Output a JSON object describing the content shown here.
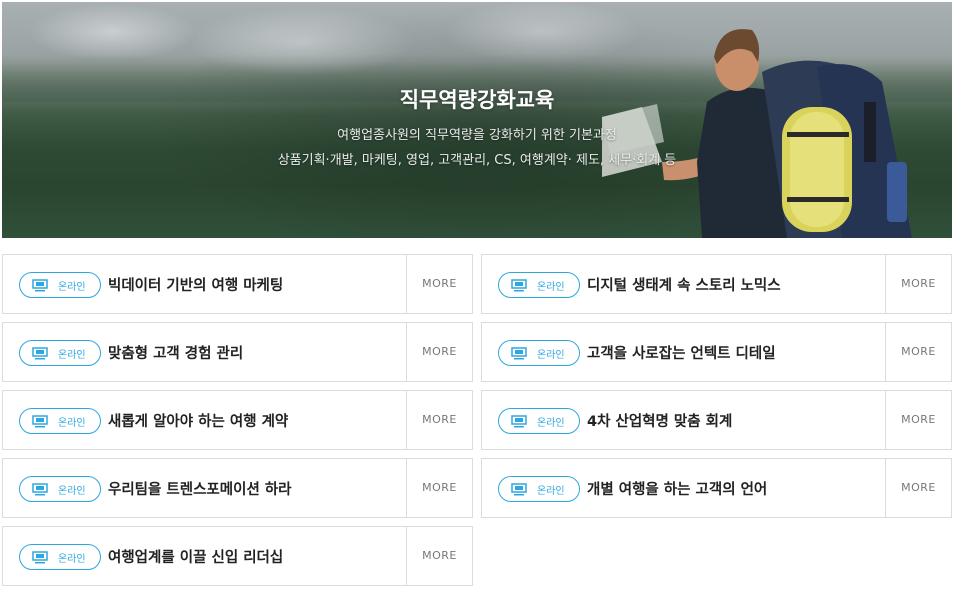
{
  "hero": {
    "title": "직무역량강화교육",
    "subtitle_line1": "여행업종사원의 직무역량을 강화하기 위한 기본과정",
    "subtitle_line2": "상품기획·개발, 마케팅, 영업, 고객관리, CS, 여행계약· 제도, 세무·회계 등"
  },
  "badge_label": "온라인",
  "more_label": "MORE",
  "courses": [
    {
      "title": "빅데이터 기반의 여행 마케팅"
    },
    {
      "title": "디지털 생태계 속 스토리 노믹스"
    },
    {
      "title": "맞춤형 고객 경험 관리"
    },
    {
      "title": "고객을 사로잡는 언텍트 디테일"
    },
    {
      "title": "새롭게 알아야 하는 여행 계약"
    },
    {
      "title": "4차 산업혁명 맞춤 회계"
    },
    {
      "title": "우리팀을 트렌스포메이션 하라"
    },
    {
      "title": "개별 여행을 하는 고객의 언어"
    },
    {
      "title": "여행업계를 이끌 신입 리더십"
    }
  ],
  "colors": {
    "accent": "#2ea7e0",
    "border": "#dcdcdc",
    "more_text": "#777777"
  }
}
